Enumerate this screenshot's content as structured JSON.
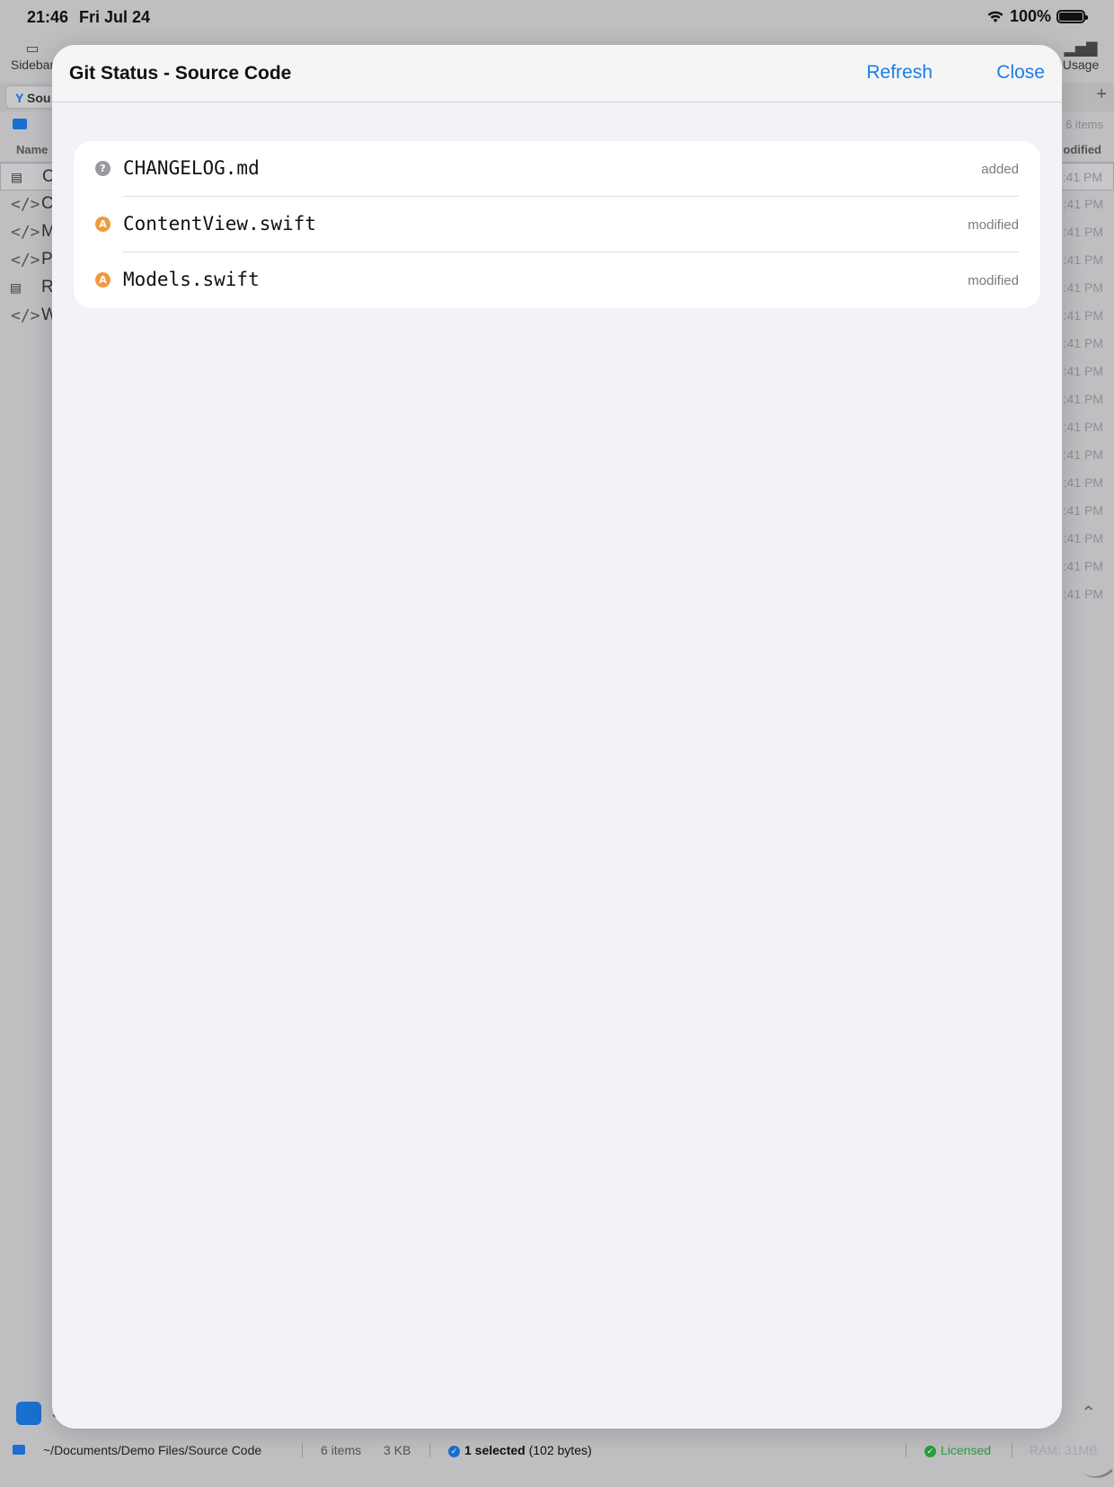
{
  "status_bar": {
    "time": "21:46",
    "date": "Fri Jul 24",
    "battery": "100%",
    "battery_level": 1.0
  },
  "toolbar": {
    "left_label": "Sidebar",
    "right_label": "Usage"
  },
  "tab": {
    "label": "Sou"
  },
  "path_row": {
    "items_count": "6 items"
  },
  "file_list": {
    "name_header": "Name",
    "modified_header": "odified",
    "rows": [
      {
        "name": "C",
        "time": ":41 PM"
      },
      {
        "name": "C",
        "time": ":41 PM"
      },
      {
        "name": "M",
        "time": ":41 PM"
      },
      {
        "name": "P",
        "time": ":41 PM"
      },
      {
        "name": "R",
        "time": ":41 PM"
      },
      {
        "name": "W",
        "time": ":41 PM"
      }
    ],
    "extra_times": [
      ":41 PM",
      ":41 PM",
      ":41 PM",
      ":41 PM",
      ":41 PM",
      ":41 PM",
      ":41 PM",
      ":41 PM",
      ":41 PM",
      ":41 PM"
    ]
  },
  "bottom_bar": {
    "label": "S"
  },
  "footer": {
    "path": "~/Documents/Demo Files/Source Code",
    "items": "6 items",
    "size": "3 KB",
    "selected": "1 selected",
    "selected_bytes": "(102 bytes)",
    "license": "Licensed",
    "ram": "RAM: 31MB"
  },
  "sheet": {
    "title": "Git Status - Source Code",
    "refresh_label": "Refresh",
    "close_label": "Close",
    "files": [
      {
        "name": "CHANGELOG.md",
        "status": "added",
        "badge": "?"
      },
      {
        "name": "ContentView.swift",
        "status": "modified",
        "badge": "A"
      },
      {
        "name": "Models.swift",
        "status": "modified",
        "badge": "A"
      }
    ]
  },
  "colors": {
    "accent": "#1a7ee6",
    "modified": "#f09a3e",
    "added": "#9a9a9e",
    "licensed": "#2a9d3e"
  }
}
